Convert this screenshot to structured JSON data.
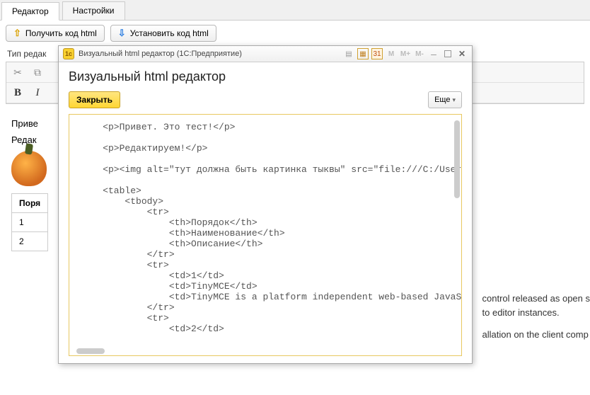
{
  "tabs": {
    "editor": "Редактор",
    "settings": "Настройки"
  },
  "toolbar": {
    "get_html": "Получить код html",
    "set_html": "Установить код html"
  },
  "label": {
    "editor_type": "Тип редак"
  },
  "format": {
    "bold": "B",
    "italic": "I"
  },
  "content": {
    "hello": "Приве",
    "editing": "Редак"
  },
  "bg_table": {
    "header": "Поря",
    "rows": [
      "1",
      "2"
    ],
    "desc1": "control released as open s",
    "desc2": "to editor instances.",
    "desc3": "allation on the client comp"
  },
  "dialog": {
    "window_title": "Визуальный html редактор  (1С:Предприятие)",
    "heading": "Визуальный html редактор",
    "close_btn": "Закрыть",
    "more_btn": "Еще",
    "title_m": "M",
    "title_mplus": "M+",
    "title_mminus": "M-",
    "code": "    <p>Привет. Это тест!</p>\n\n    <p>Редактируем!</p>\n\n    <p><img alt=\"тут должна быть картинка тыквы\" src=\"file:///C:/User\n\n    <table>\n        <tbody>\n            <tr>\n                <th>Порядок</th>\n                <th>Наименование</th>\n                <th>Описание</th>\n            </tr>\n            <tr>\n                <td>1</td>\n                <td>TinyMCE</td>\n                <td>TinyMCE is a platform independent web-based JavaS\n            </tr>\n            <tr>\n                <td>2</td>"
  }
}
